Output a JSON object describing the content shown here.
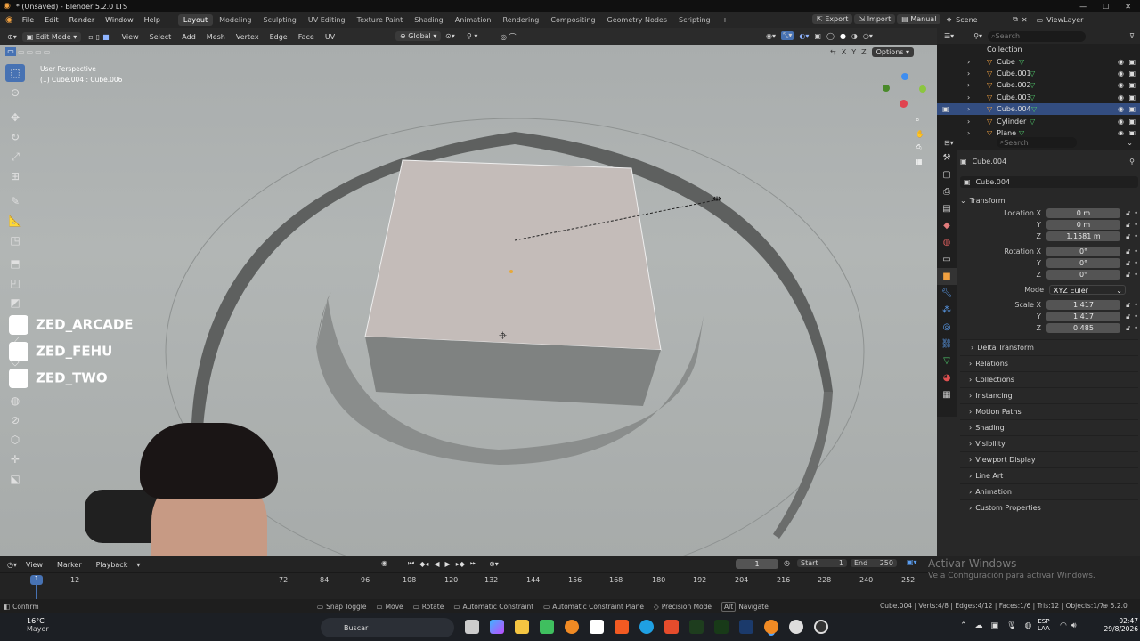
{
  "titlebar": {
    "title": "* (Unsaved) - Blender 5.2.0 LTS"
  },
  "menubar": {
    "menus": [
      "File",
      "Edit",
      "Render",
      "Window",
      "Help"
    ],
    "workspaces": [
      "Layout",
      "Modeling",
      "Sculpting",
      "UV Editing",
      "Texture Paint",
      "Shading",
      "Animation",
      "Rendering",
      "Compositing",
      "Geometry Nodes",
      "Scripting"
    ],
    "add_tab": "+",
    "export": "Export",
    "import": "Import",
    "manual": "Manual",
    "scene": "Scene",
    "viewlayer": "ViewLayer"
  },
  "viewport_header": {
    "mode": "Edit Mode",
    "menus": [
      "View",
      "Select",
      "Add",
      "Mesh",
      "Vertex",
      "Edge",
      "Face",
      "UV"
    ],
    "orientation": "Global",
    "options": "Options",
    "axes": [
      "X",
      "Y",
      "Z"
    ]
  },
  "viewport": {
    "perspective": "User Perspective",
    "object_info": "(1) Cube.004 : Cube.006"
  },
  "overlay_social": [
    "ZED_ARCADE",
    "ZED_FEHU",
    "ZED_TWO"
  ],
  "outliner": {
    "search_placeholder": "Search",
    "collection": "Collection",
    "items": [
      "Cube",
      "Cube.001",
      "Cube.002",
      "Cube.003",
      "Cube.004",
      "Cylinder",
      "Plane"
    ],
    "selected": "Cube.004"
  },
  "properties": {
    "search_placeholder": "Search",
    "object_name": "Cube.004",
    "object_field": "Cube.004",
    "transform_label": "Transform",
    "location": {
      "label_x": "Location X",
      "label_y": "Y",
      "label_z": "Z",
      "x": "0 m",
      "y": "0 m",
      "z": "1.1581 m"
    },
    "rotation": {
      "label_x": "Rotation X",
      "label_y": "Y",
      "label_z": "Z",
      "x": "0°",
      "y": "0°",
      "z": "0°"
    },
    "mode": {
      "label": "Mode",
      "value": "XYZ Euler"
    },
    "scale": {
      "label_x": "Scale X",
      "label_y": "Y",
      "label_z": "Z",
      "x": "1.417",
      "y": "1.417",
      "z": "0.485"
    },
    "delta_transform": "Delta Transform",
    "panels": [
      "Relations",
      "Collections",
      "Instancing",
      "Motion Paths",
      "Shading",
      "Visibility",
      "Viewport Display",
      "Line Art",
      "Animation",
      "Custom Properties"
    ]
  },
  "timeline": {
    "menus": [
      "View",
      "Marker",
      "Playback"
    ],
    "current_frame": "1",
    "start_label": "Start",
    "start": "1",
    "end_label": "End",
    "end": "250",
    "ticks": [
      "1",
      "12",
      "72",
      "84",
      "96",
      "108",
      "120",
      "132",
      "144",
      "156",
      "168",
      "180",
      "192",
      "204",
      "216",
      "228",
      "240",
      "252"
    ]
  },
  "statusbar": {
    "items": [
      "Confirm",
      "Snap Toggle",
      "Move",
      "Rotate",
      "Automatic Constraint",
      "Automatic Constraint Plane",
      "Precision Mode",
      "Navigate"
    ],
    "alt_key": "Alt",
    "stats": "Cube.004 | Verts:4/8 | Edges:4/12 | Faces:1/6 | Tris:12 | Objects:1/7",
    "version": "5.2.0"
  },
  "watermark": {
    "line1": "Activar Windows",
    "line2": "Ve a Configuración para activar Windows."
  },
  "taskbar": {
    "weather_temp": "16°C",
    "weather_desc": "Mayor",
    "search": "Buscar",
    "lang": "ESP",
    "lang2": "LAA",
    "time": "02:47",
    "date": "29/8/2026"
  }
}
